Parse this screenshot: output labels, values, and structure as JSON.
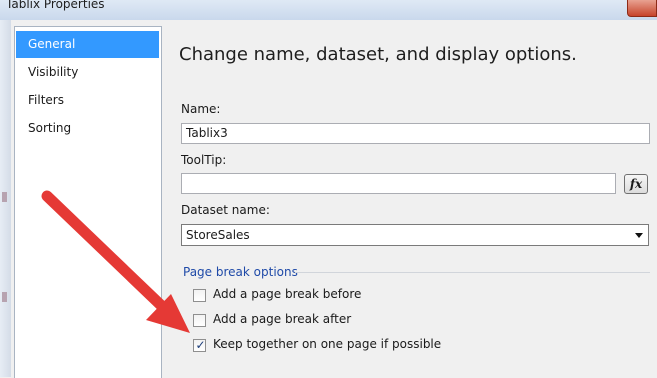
{
  "window": {
    "title": "Tablix Properties"
  },
  "nav": {
    "items": [
      {
        "label": "General",
        "selected": true
      },
      {
        "label": "Visibility",
        "selected": false
      },
      {
        "label": "Filters",
        "selected": false
      },
      {
        "label": "Sorting",
        "selected": false
      }
    ]
  },
  "main": {
    "heading": "Change name, dataset, and display options.",
    "name_label": "Name:",
    "name_value": "Tablix3",
    "tooltip_label": "ToolTip:",
    "tooltip_value": "",
    "expression_button": "fx",
    "dataset_label": "Dataset name:",
    "dataset_value": "StoreSales",
    "page_break": {
      "title": "Page break options",
      "options": [
        {
          "label": "Add a page break before",
          "checked": false
        },
        {
          "label": "Add a page break after",
          "checked": false
        },
        {
          "label": "Keep together on one page if possible",
          "checked": true
        }
      ]
    }
  },
  "colors": {
    "selection": "#3399ff",
    "group_title": "#1f4aa8",
    "arrow": "#e53935"
  }
}
